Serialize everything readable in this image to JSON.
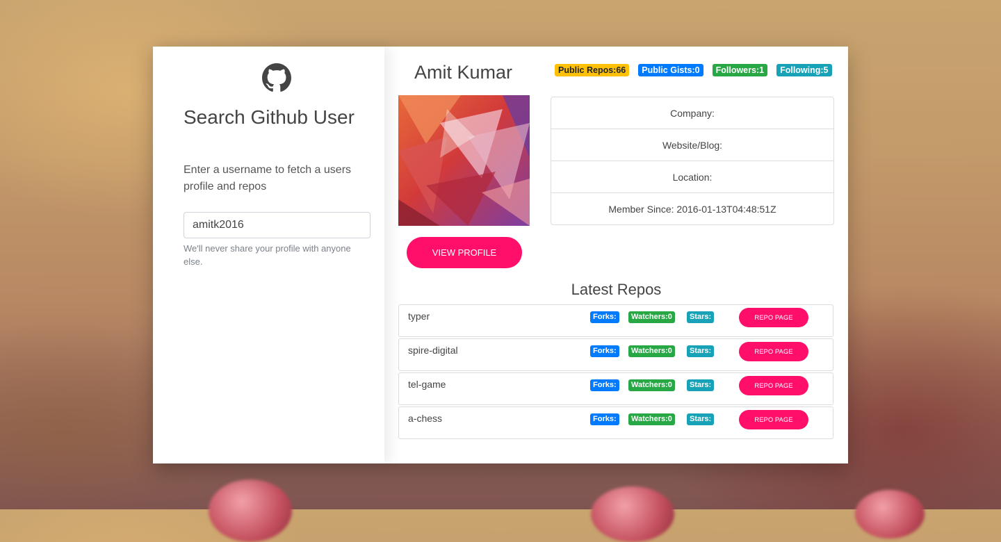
{
  "search": {
    "title": "Search Github User",
    "lead": "Enter a username to fetch a users profile and repos",
    "input_value": "amitk2016",
    "help": "We'll never share your profile with anyone else."
  },
  "profile": {
    "name": "Amit Kumar",
    "badges": {
      "public_repos": "Public Repos:66",
      "public_gists": "Public Gists:0",
      "followers": "Followers:1",
      "following": "Following:5"
    },
    "view_button": "VIEW PROFILE",
    "info": {
      "company": "Company:",
      "website": "Website/Blog:",
      "location": "Location:",
      "member_since": "Member Since: 2016-01-13T04:48:51Z"
    }
  },
  "repos": {
    "title": "Latest Repos",
    "items": [
      {
        "name": "typer",
        "forks": "Forks:",
        "watchers": "Watchers:0",
        "stars": "Stars:",
        "button": "REPO PAGE"
      },
      {
        "name": "spire-digital",
        "forks": "Forks:",
        "watchers": "Watchers:0",
        "stars": "Stars:",
        "button": "REPO PAGE"
      },
      {
        "name": "tel-game",
        "forks": "Forks:",
        "watchers": "Watchers:0",
        "stars": "Stars:",
        "button": "REPO PAGE"
      },
      {
        "name": "a-chess",
        "forks": "Forks:",
        "watchers": "Watchers:0",
        "stars": "Stars:",
        "button": "REPO PAGE"
      }
    ]
  },
  "colors": {
    "accent": "#ff0f6a",
    "badge_yellow": "#ffc107",
    "badge_blue": "#007bff",
    "badge_green": "#28a745",
    "badge_teal": "#17a2b8"
  },
  "icons": {
    "logo": "github-icon"
  }
}
